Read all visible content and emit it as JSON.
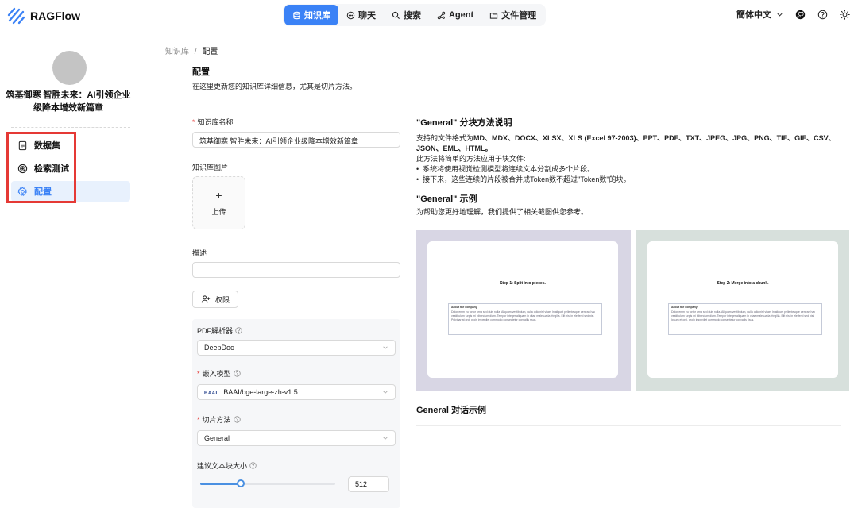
{
  "app": {
    "name": "RAGFlow"
  },
  "nav": {
    "items": [
      {
        "label": "知识库",
        "icon": "database-icon",
        "active": true
      },
      {
        "label": "聊天",
        "icon": "chat-icon",
        "active": false
      },
      {
        "label": "搜索",
        "icon": "search-icon",
        "active": false
      },
      {
        "label": "Agent",
        "icon": "agent-icon",
        "active": false
      },
      {
        "label": "文件管理",
        "icon": "folder-icon",
        "active": false
      }
    ]
  },
  "header": {
    "language": "簡体中文"
  },
  "sidebar": {
    "kb_name": "筑基御寒 智胜未来：AI引领企业级降本增效新篇章",
    "items": [
      {
        "label": "数据集",
        "icon": "dataset-icon",
        "active": false
      },
      {
        "label": "检索测试",
        "icon": "retrieval-test-icon",
        "active": false
      },
      {
        "label": "配置",
        "icon": "gear-icon",
        "active": true
      }
    ]
  },
  "breadcrumb": {
    "root": "知识库",
    "separator": "/",
    "current": "配置"
  },
  "page": {
    "title": "配置",
    "description": "在这里更新您的知识库详细信息，尤其是切片方法。"
  },
  "form": {
    "kb_name_label": "知识库名称",
    "kb_name_value": "筑基御寒 智胜未来：AI引领企业级降本增效新篇章",
    "kb_image_label": "知识库图片",
    "upload_plus": "+",
    "upload_label": "上传",
    "desc_label": "描述",
    "desc_value": "",
    "permission_label": "权限",
    "pdf_parser_label": "PDF解析器",
    "pdf_parser_value": "DeepDoc",
    "embedding_label": "嵌入模型",
    "embedding_badge": "BAAI",
    "embedding_value": "BAAI/bge-large-zh-v1.5",
    "chunk_method_label": "切片方法",
    "chunk_method_value": "General",
    "chunk_size_label": "建议文本块大小",
    "chunk_size_value": "512",
    "chunk_size_fraction": 0.3
  },
  "docs": {
    "heading": "\"General\" 分块方法说明",
    "formats_prefix": "支持的文件格式为",
    "formats": "MD、MDX、DOCX、XLSX、XLS (Excel 97-2003)、PPT、PDF、TXT、JPEG、JPG、PNG、TIF、GIF、CSV、JSON、EML、HTML。",
    "method_intro": "此方法将简单的方法应用于块文件:",
    "bullets": [
      "系统将使用视觉检测模型将连续文本分割成多个片段。",
      "接下来，这些连续的片段被合并成Token数不超过\"Token数\"的块。"
    ],
    "example_heading": "\"General\" 示例",
    "example_desc": "为帮助您更好地理解，我们提供了相关截图供您参考。",
    "examples": [
      {
        "step": "Step 1: Split into pieces.",
        "box_title": "About the company",
        "box_text": "Dolor enim eu tortor urna sed duis nulla. Aliquam vestibulum, nulla odio nisl vitae. In aliquet pellentesque aenean hac vestibulum turpis mi bibendum diam. Tempor integer aliquam in vitae malesuada fringilla. Elit nisi in eleifend sed nisi. Pulvinar at orci, proin imperdiet commodo consectetur convallis risus."
      },
      {
        "step": "Step 2: Merge into a chunk.",
        "box_title": "About the company",
        "box_text": "Dolor enim eu tortor urna sed duis nulla. Aliquam vestibulum, nulla odio nisl vitae. In aliquet pellentesque aenean hac vestibulum turpis mi bibendum diam. Tempor integer aliquam in vitae malesuada fringilla. Elit nisi in eleifend sed nisi. Ipsum et orci, proin imperdiet commodo consectetur convallis risus."
      }
    ],
    "dialog_heading": "General 对话示例"
  },
  "colors": {
    "accent": "#3b82f6",
    "required": "#e53935",
    "annotation_box": "#e53935",
    "example1_bg": "#d8d6e4",
    "example2_bg": "#d7e0dc"
  }
}
